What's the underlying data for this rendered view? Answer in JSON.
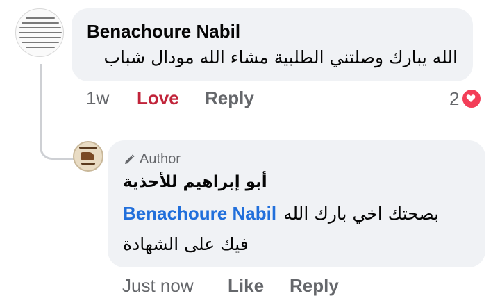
{
  "comment": {
    "author_name": "Benachoure Nabil",
    "text": "الله يبارك وصلتني الطلبية مشاء الله مودال شباب",
    "time": "1w",
    "love_label": "Love",
    "reply_label": "Reply",
    "reaction_count": "2",
    "reaction_icon": "heart-icon",
    "love_color": "#c1243a"
  },
  "reply": {
    "author_badge": "Author",
    "author_name": "أبو إبراهيم للأحذية",
    "mention": "Benachoure Nabil",
    "text_line1": "بصحتك اخي بارك الله",
    "text_line2": "فيك على الشهادة",
    "time": "Just now",
    "like_label": "Like",
    "reply_label": "Reply",
    "mention_color": "#216fdb"
  }
}
